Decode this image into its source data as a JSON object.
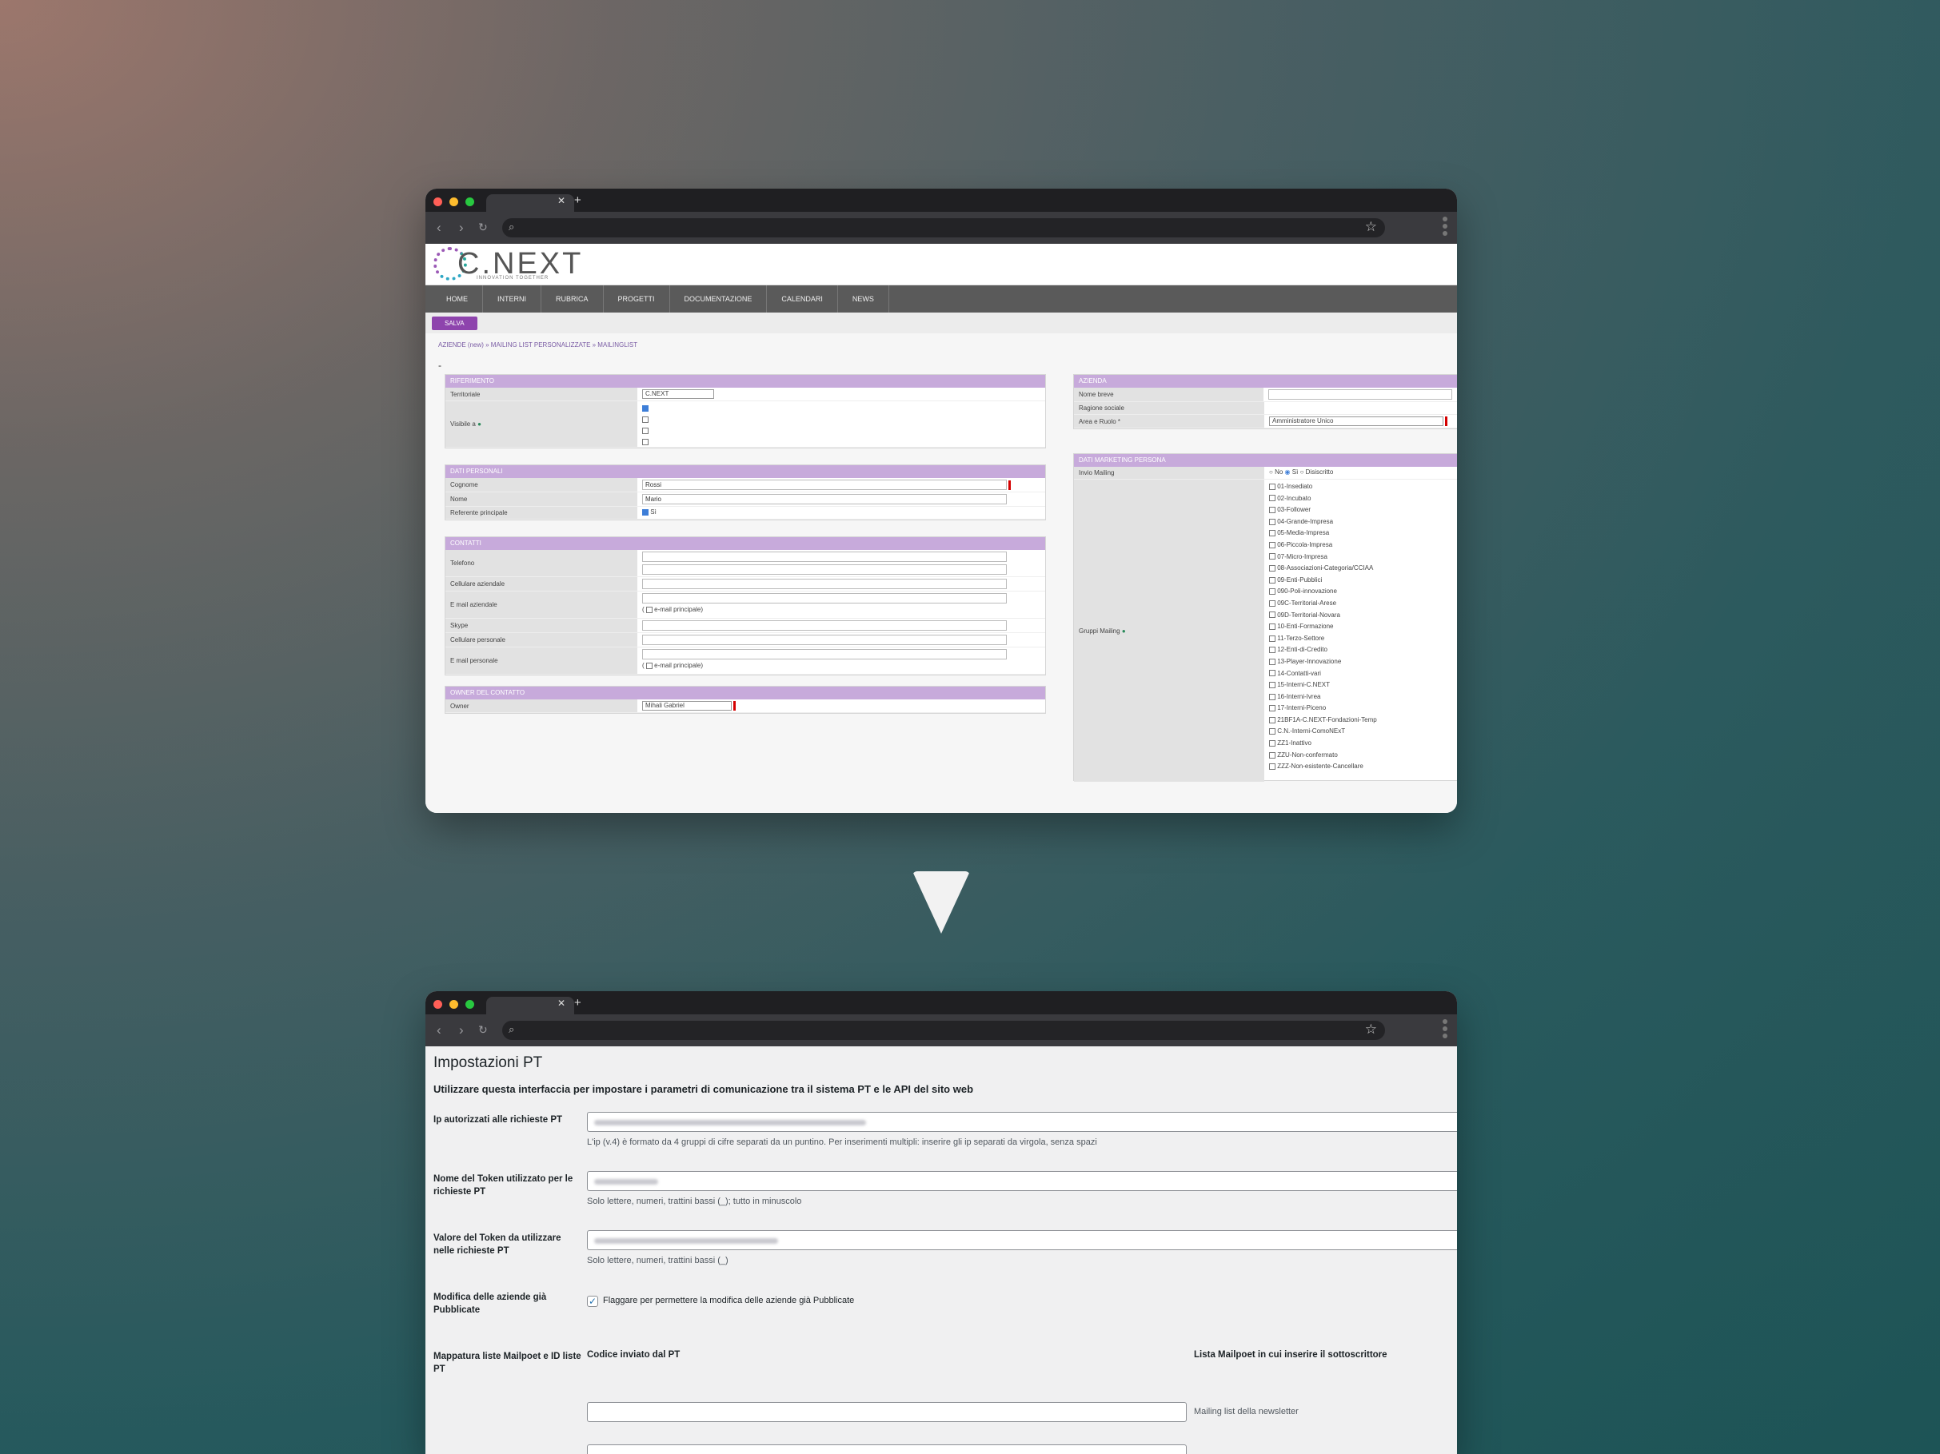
{
  "crm": {
    "logo": {
      "text": "C.NEXT",
      "tagline": "INNOVATION TOGETHER"
    },
    "nav": [
      "HOME",
      "INTERNI",
      "RUBRICA",
      "PROGETTI",
      "DOCUMENTAZIONE",
      "CALENDARI",
      "NEWS"
    ],
    "save_label": "SALVA",
    "breadcrumb": "AZIENDE (new) »  MAILING LIST PERSONALIZZATE »  MAILINGLIST",
    "dash": "-",
    "riferimento": {
      "title": "RIFERIMENTO",
      "territoriale_label": "Territoriale",
      "territoriale_value": "C.NEXT",
      "visibile_label": "Visibile a"
    },
    "dati_personali": {
      "title": "DATI PERSONALI",
      "cognome_label": "Cognome",
      "cognome_value": "Rossi",
      "nome_label": "Nome",
      "nome_value": "Mario",
      "referente_label": "Referente principale",
      "referente_value": "Sì"
    },
    "contatti": {
      "title": "CONTATTI",
      "telefono": "Telefono",
      "cell_az": "Cellulare aziendale",
      "email_az": "E mail aziendale",
      "email_principale": "e-mail principale",
      "skype": "Skype",
      "cell_pers": "Cellulare personale",
      "email_pers": "E mail personale"
    },
    "owner": {
      "title": "OWNER DEL CONTATTO",
      "label": "Owner",
      "value": "Mihali Gabriel"
    },
    "azienda": {
      "title": "AZIENDA",
      "nome_breve": "Nome breve",
      "ragione_sociale": "Ragione sociale",
      "area_ruolo": "Area e Ruolo *",
      "area_ruolo_value": "Amministratore Unico"
    },
    "marketing": {
      "title": "DATI MARKETING PERSONA",
      "invio_label": "Invio Mailing",
      "opt_no": "No",
      "opt_si": "Sì",
      "opt_dis": "Disiscritto",
      "gruppi_label": "Gruppi Mailing",
      "gruppi": [
        "01-Insediato",
        "02-Incubato",
        "03-Follower",
        "04-Grande-Impresa",
        "05-Media-Impresa",
        "06-Piccola-Impresa",
        "07-Micro-Impresa",
        "08-Associazioni-Categoria/CCIAA",
        "09-Enti-Pubblici",
        "090-Poli-innovazione",
        "09C-Territorial-Arese",
        "09D-Territorial-Novara",
        "10-Enti-Formazione",
        "11-Terzo-Settore",
        "12-Enti-di-Credito",
        "13-Player-Innovazione",
        "14-Contatti-vari",
        "15-Interni-C.NEXT",
        "16-Interni-Ivrea",
        "17-Interni-Piceno",
        "21BF1A-C.NEXT-Fondazioni-Temp",
        "C.N.-Interni-ComoNExT",
        "ZZ1-Inattivo",
        "ZZU-Non-confermato",
        "ZZZ-Non-esistente-Cancellare"
      ]
    }
  },
  "settings": {
    "title": "Impostazioni PT",
    "intro": "Utilizzare questa interfaccia per impostare i parametri di comunicazione tra il sistema PT e le API del sito web",
    "ip_label": "Ip autorizzati alle richieste PT",
    "ip_help": "L'ip (v.4) è formato da 4 gruppi di cifre separati da un puntino. Per inserimenti multipli: inserire gli ip separati da virgola, senza spazi",
    "token_name_label": "Nome del Token utilizzato per le richieste PT",
    "token_name_help": "Solo lettere, numeri, trattini bassi (_); tutto in minuscolo",
    "token_value_label": "Valore del Token da utilizzare nelle richieste PT",
    "token_value_help": "Solo lettere, numeri, trattini bassi (_)",
    "modify_label": "Modifica delle aziende già Pubblicate",
    "modify_check": "Flaggare per permettere la modifica delle aziende già Pubblicate",
    "mapping_label": "Mappatura liste Mailpoet e ID liste PT",
    "col_code": "Codice inviato dal PT",
    "col_list": "Lista Mailpoet in cui inserire il sottoscrittore",
    "row1_list": "Mailing list della newsletter"
  },
  "colors": {
    "accent": "#8e44ad",
    "header_purple": "#c7aadb",
    "wp_blue": "#2271b1"
  }
}
